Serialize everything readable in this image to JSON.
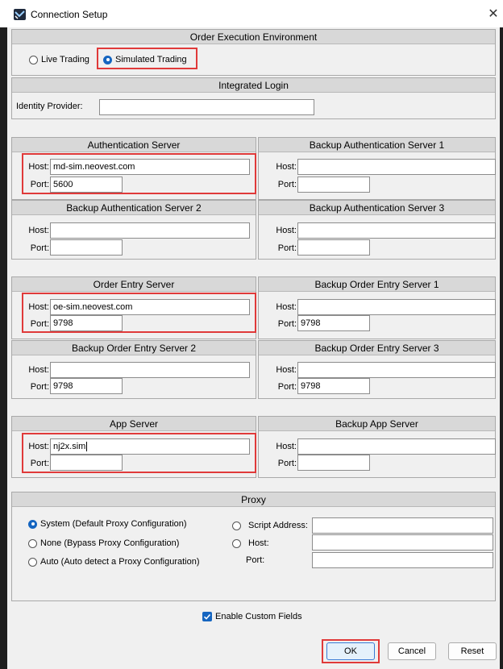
{
  "window": {
    "title": "Connection Setup",
    "close_glyph": "✕",
    "app_icon": "neovest-icon"
  },
  "order_env": {
    "header": "Order Execution Environment",
    "live_label": "Live Trading",
    "sim_label": "Simulated Trading",
    "selected": "Simulated Trading"
  },
  "integrated_login": {
    "header": "Integrated Login",
    "identity_label": "Identity Provider:",
    "identity_value": ""
  },
  "labels": {
    "host": "Host:",
    "port": "Port:"
  },
  "auth": {
    "header": "Authentication Server",
    "host": "md-sim.neovest.com",
    "port": "5600"
  },
  "backup_auth_1": {
    "header": "Backup Authentication Server 1",
    "host": "",
    "port": ""
  },
  "backup_auth_2": {
    "header": "Backup Authentication Server 2",
    "host": "",
    "port": ""
  },
  "backup_auth_3": {
    "header": "Backup Authentication Server 3",
    "host": "",
    "port": ""
  },
  "order_entry": {
    "header": "Order Entry Server",
    "host": "oe-sim.neovest.com",
    "port": "9798"
  },
  "backup_oe_1": {
    "header": "Backup Order Entry Server 1",
    "host": "",
    "port": "9798"
  },
  "backup_oe_2": {
    "header": "Backup Order Entry Server 2",
    "host": "",
    "port": "9798"
  },
  "backup_oe_3": {
    "header": "Backup Order Entry Server 3",
    "host": "",
    "port": "9798"
  },
  "app_server": {
    "header": "App Server",
    "host": "nj2x.sim",
    "port": ""
  },
  "backup_app": {
    "header": "Backup App Server",
    "host": "",
    "port": ""
  },
  "proxy": {
    "header": "Proxy",
    "system_label": "System (Default Proxy Configuration)",
    "none_label": "None (Bypass Proxy Configuration)",
    "auto_label": "Auto (Auto detect a Proxy Configuration)",
    "script_label": "Script Address:",
    "host_label": "Host:",
    "port_label": "Port:",
    "selected": "System (Default Proxy Configuration)",
    "script_value": "",
    "host_value": "",
    "port_value": ""
  },
  "custom_fields": {
    "label": "Enable Custom Fields",
    "checked": true
  },
  "buttons": {
    "ok": "OK",
    "cancel": "Cancel",
    "reset": "Reset"
  },
  "colors": {
    "highlight": "#e03a3a",
    "accent": "#1565c0"
  }
}
